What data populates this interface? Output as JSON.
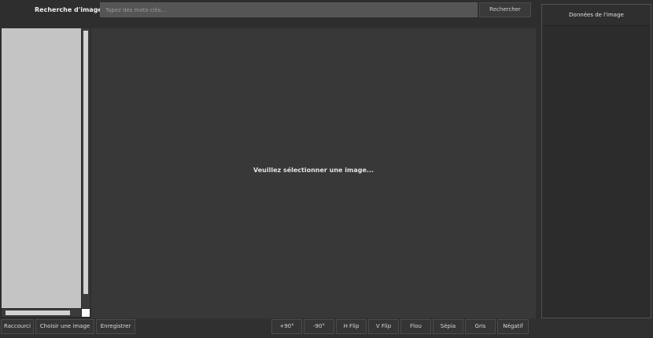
{
  "search": {
    "label": "Recherche d'image",
    "placeholder": "Tapez des mots-clés...",
    "button": "Rechercher"
  },
  "viewer": {
    "message": "Veuillez sélectionner une image..."
  },
  "details_panel": {
    "title": "Données de l'image"
  },
  "file_actions": [
    {
      "label": "Raccourci"
    },
    {
      "label": "Choisir une image"
    },
    {
      "label": "Enregistrer"
    }
  ],
  "image_tools": [
    {
      "label": "+90°"
    },
    {
      "label": "-90°"
    },
    {
      "label": "H Flip"
    },
    {
      "label": "V Flip"
    },
    {
      "label": "Flou"
    },
    {
      "label": "Sépia"
    },
    {
      "label": "Gris"
    },
    {
      "label": "Négatif"
    }
  ],
  "colors": {
    "background": "#2e2e2e",
    "list_area": "#c4c4c4",
    "viewer": "#383838"
  }
}
